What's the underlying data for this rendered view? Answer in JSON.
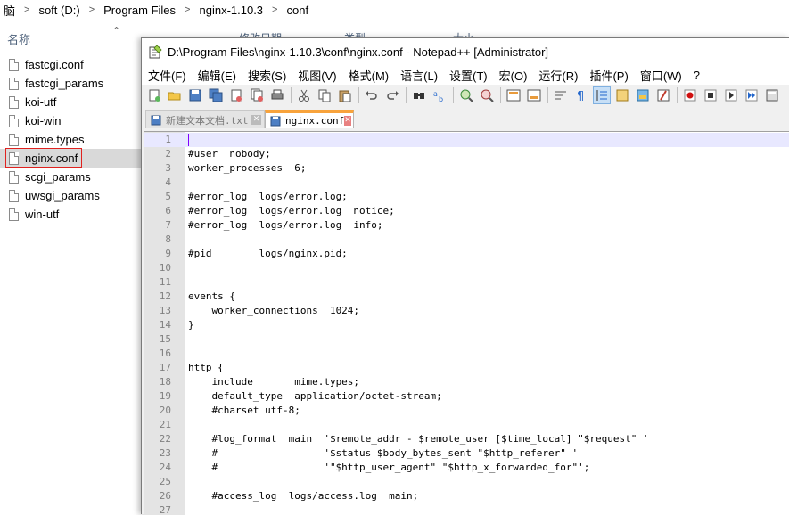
{
  "explorer": {
    "breadcrumb": [
      "脑",
      "soft (D:)",
      "Program Files",
      "nginx-1.10.3",
      "conf"
    ],
    "columns": {
      "name": "名称",
      "date": "修改日期",
      "type": "类型",
      "size": "大小"
    },
    "files": [
      {
        "name": "fastcgi.conf",
        "selected": false
      },
      {
        "name": "fastcgi_params",
        "selected": false
      },
      {
        "name": "koi-utf",
        "selected": false
      },
      {
        "name": "koi-win",
        "selected": false
      },
      {
        "name": "mime.types",
        "selected": false
      },
      {
        "name": "nginx.conf",
        "selected": true
      },
      {
        "name": "scgi_params",
        "selected": false
      },
      {
        "name": "uwsgi_params",
        "selected": false
      },
      {
        "name": "win-utf",
        "selected": false
      }
    ]
  },
  "npp": {
    "title": "D:\\Program Files\\nginx-1.10.3\\conf\\nginx.conf - Notepad++ [Administrator]",
    "menu": [
      "文件(F)",
      "编辑(E)",
      "搜索(S)",
      "视图(V)",
      "格式(M)",
      "语言(L)",
      "设置(T)",
      "宏(O)",
      "运行(R)",
      "插件(P)",
      "窗口(W)",
      "?"
    ],
    "tabs": [
      {
        "label": "新建文本文档.txt",
        "active": false
      },
      {
        "label": "nginx.conf",
        "active": true
      }
    ],
    "lines": [
      "",
      "#user  nobody;",
      "worker_processes  6;",
      "",
      "#error_log  logs/error.log;",
      "#error_log  logs/error.log  notice;",
      "#error_log  logs/error.log  info;",
      "",
      "#pid        logs/nginx.pid;",
      "",
      "",
      "events {",
      "    worker_connections  1024;",
      "}",
      "",
      "",
      "http {",
      "    include       mime.types;",
      "    default_type  application/octet-stream;",
      "    #charset utf-8;",
      "",
      "    #log_format  main  '$remote_addr - $remote_user [$time_local] \"$request\" '",
      "    #                  '$status $body_bytes_sent \"$http_referer\" '",
      "    #                  '\"$http_user_agent\" \"$http_x_forwarded_for\"';",
      "",
      "    #access_log  logs/access.log  main;",
      ""
    ],
    "current_line": 1,
    "colors": {
      "accent_tab": "#f8a33c",
      "current_line": "#e8e8ff",
      "gutter": "#e4e4e4",
      "selection_box": "#e0221f"
    }
  }
}
